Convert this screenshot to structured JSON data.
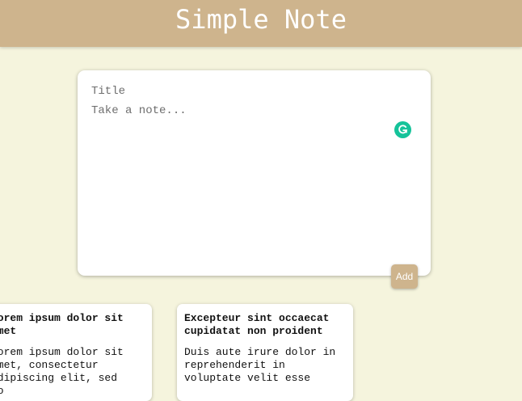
{
  "header": {
    "title": "Simple Note"
  },
  "composer": {
    "title_placeholder": "Title",
    "title_value": "",
    "body_placeholder": "Take a note...",
    "body_value": "",
    "add_label": "Add",
    "grammarly_icon": "grammarly-icon"
  },
  "notes": [
    {
      "title": "Lorem ipsum dolor sit amet",
      "body": "Lorem ipsum dolor sit amet, consectetur adipiscing elit, sed do"
    },
    {
      "title": "Excepteur sint occaecat cupidatat non proident",
      "body": "Duis aute irure dolor in reprehenderit in voluptate velit esse"
    }
  ],
  "colors": {
    "accent": "#ceb48d",
    "background": "#f5f4dd",
    "grammarly": "#15c39a"
  }
}
